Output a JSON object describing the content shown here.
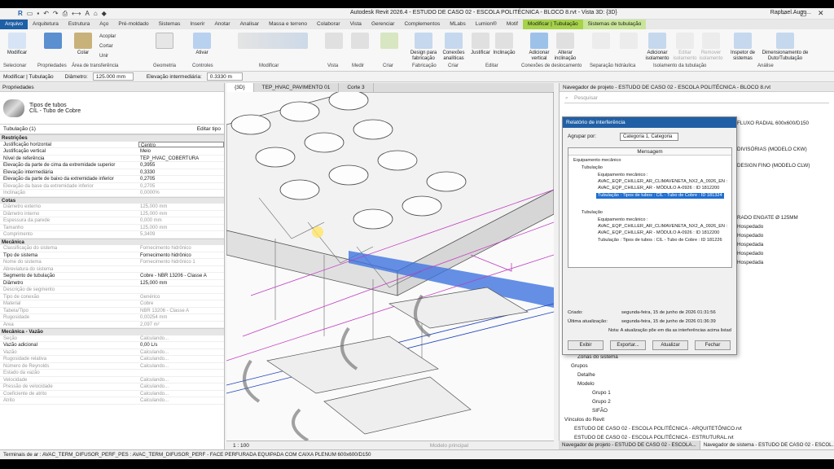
{
  "title": {
    "app": "Autodesk Revit 2026.4 - ESTUDO DE CASO 02 - ESCOLA POLITÉCNICA - BLOCO 8.rvt - Vista 3D: {3D}",
    "user": "Raphael.Augu..."
  },
  "tabs": [
    "Arquivo",
    "Arquitetura",
    "Estrutura",
    "Aço",
    "Pré-moldado",
    "Sistemas",
    "Inserir",
    "Anotar",
    "Analisar",
    "Massa e terreno",
    "Colaborar",
    "Vista",
    "Gerenciar",
    "Complementos",
    "MLabs",
    "Lumion®",
    "Motif",
    "Modificar | Tubulação",
    "Sistemas de tubulação"
  ],
  "ribbon": {
    "modify": "Modificar",
    "select": "Selecionar",
    "properties": "Propriedades",
    "clipboard": "Área de transferência",
    "geometry": "Geometria",
    "controls": "Controles",
    "modify_group": "Modificar",
    "view": "Vista",
    "measure": "Medir",
    "create": "Criar",
    "fabrication": "Fabricação",
    "create2": "Criar",
    "edit": "Editar",
    "offset_conn": "Conexões de deslocamento",
    "hydr_sep": "Separação hidráulica",
    "insul": "Isolamento da tubulação",
    "analysis": "Análise",
    "paste": "Colar",
    "cut": "Cortar",
    "join": "Unir",
    "copy": "Acoplar",
    "activate": "Ativar",
    "design_fab": "Design para fabricação",
    "analytic_conn": "Conexões analíticas",
    "justify": "Justificar",
    "slope": "Inclinação",
    "add_vertical": "Adicionar vertical",
    "change_slope": "Alterar inclinação",
    "add_insul": "Adicionar isolamento",
    "edit_insul": "Editar isolamento",
    "remove_insul": "Remover isolamento",
    "inspector": "Inspetor de sistemas",
    "sizing": "Dimensionamento de Duto/Tubulação"
  },
  "optbar": {
    "context": "Modificar | Tubulação",
    "diam_label": "Diâmetro:",
    "diam_value": "125.000 mm",
    "elev_label": "Elevação intermediária:",
    "elev_value": "0.3330 m"
  },
  "props": {
    "header": "Propriedades",
    "type_family": "Tipos de tubos",
    "type_name": "CIL - Tubo de Cobre",
    "selector": "Tubulação (1)",
    "edit_type": "Editar tipo",
    "sections": [
      {
        "name": "Restrições",
        "rows": [
          [
            "Justificação horizontal",
            "Centro",
            0,
            1
          ],
          [
            "Justificação vertical",
            "Meio",
            0,
            0
          ],
          [
            "Nível de referência",
            "TEP_HVAC_COBERTURA",
            0,
            0
          ],
          [
            "Elevação da parte de cima da extremidade superior",
            "0,3955",
            0,
            0
          ],
          [
            "Elevação intermediária",
            "0,3330",
            0,
            0
          ],
          [
            "Elevação da parte de baixo da extremidade inferior",
            "0,2705",
            0,
            0
          ],
          [
            "Elevação da base da extremidade inferior",
            "0,2705",
            1,
            0
          ],
          [
            "Inclinação",
            "0,0000%",
            1,
            0
          ]
        ]
      },
      {
        "name": "Cotas",
        "rows": [
          [
            "Diâmetro externo",
            "125,000 mm",
            1,
            0
          ],
          [
            "Diâmetro interno",
            "125,000 mm",
            1,
            0
          ],
          [
            "Espessura da parede",
            "0,000 mm",
            1,
            0
          ],
          [
            "Tamanho",
            "125,000 mm",
            1,
            0
          ],
          [
            "Comprimento",
            "5,3409",
            1,
            0
          ]
        ]
      },
      {
        "name": "Mecânica",
        "rows": [
          [
            "Classificação do sistema",
            "Fornecimento hidrônico",
            1,
            0
          ],
          [
            "Tipo de sistema",
            "Fornecimento hidrônico",
            0,
            0
          ],
          [
            "Nome do sistema",
            "Fornecimento hidrônico 1",
            1,
            0
          ],
          [
            "Abreviatura do sistema",
            "",
            1,
            0
          ],
          [
            "Segmento de tubulação",
            "Cobre - NBR 13206 - Classe A",
            0,
            0
          ],
          [
            "Diâmetro",
            "125,000 mm",
            0,
            0
          ],
          [
            "Descrição de segmento",
            "",
            1,
            0
          ],
          [
            "Tipo de conexão",
            "Genérico",
            1,
            0
          ],
          [
            "Material",
            "Cobre",
            1,
            0
          ],
          [
            "Tabela/Tipo",
            "NBR 13206 - Classe A",
            1,
            0
          ],
          [
            "Rugosidade",
            "0,00254 mm",
            1,
            0
          ],
          [
            "Área",
            "2,097 m²",
            1,
            0
          ]
        ]
      },
      {
        "name": "Mecânica - Vazão",
        "rows": [
          [
            "Seção",
            "Calculando...",
            1,
            0
          ],
          [
            "Vazão adicional",
            "0,00 L/s",
            0,
            0
          ],
          [
            "Vazão",
            "Calculando...",
            1,
            0
          ],
          [
            "Rugosidade relativa",
            "Calculando...",
            1,
            0
          ],
          [
            "Número de Reynolds",
            "Calculando...",
            1,
            0
          ],
          [
            "Estado da vazão",
            "",
            1,
            0
          ],
          [
            "Velocidade",
            "Calculando...",
            1,
            0
          ],
          [
            "Pressão de velocidade",
            "Calculando...",
            1,
            0
          ],
          [
            "Coeficiente de atrito",
            "Calculando...",
            1,
            0
          ],
          [
            "Atrito",
            "Calculando...",
            1,
            0
          ]
        ]
      }
    ],
    "help": "Ajuda de propriedades",
    "apply": "Aplicar"
  },
  "view_tabs": [
    "{3D}",
    "TEP_HVAC_PAVIMENTO 01",
    "Corte 3"
  ],
  "view_scale": "1 : 100",
  "view_label": "Modelo principal",
  "browser": {
    "title": "Navegador de projeto - ESTUDO DE CASO 02 - ESCOLA POLITÉCNICA - BLOCO 8.rvt",
    "search": "Pesquisar",
    "items": [
      "FLUXO RADIAL 600x600/D150",
      "DIVISÓRIAS (MODELO CKW)",
      "DESIGN FINO (MODELO CLW)",
      "RADO ENGATE Ø 125MM",
      "Hospedado",
      "Hospedado",
      "Hospedada",
      "Hospedado",
      "Hospedada",
      "Zonas do sistema",
      "Grupos",
      "Detalhe",
      "Modelo",
      "Grupo 1",
      "Grupo 2",
      "SIFÃO",
      "Vínculos do Revit",
      "ESTUDO DE CASO 02 - ESCOLA POLITÉCNICA - ARQUITETÔNICO.rvt",
      "ESTUDO DE CASO 02 - ESCOLA POLITÉCNICA - ESTRUTURAL.rvt"
    ],
    "tab1": "Navegador de projeto - ESTUDO DE CASO 02 - ESCOLA...",
    "tab2": "Navegador de sistema - ESTUDO DE CASO 02 - ESCOL..."
  },
  "dialog": {
    "title": "Relatório de interferência",
    "group_label": "Agrupar por:",
    "group_value": "Categoria 1, Categoria",
    "col": "Mensagem",
    "lines": [
      "Equipamento mecânico",
      "Tubulação",
      "Equipamento mecânico :",
      "AVAC_EQP_CHILLER_AR_CLIMAVENETA_NX2_A_0926_EN :",
      "AVAC_EQP_CHILLER_AR - MÓDULO A-0926 : ID 1812200",
      "Tubulação : Tipos de tubos : CIL - Tubo de Cobre : ID 181324",
      "Tubulação",
      "Equipamento mecânico :",
      "AVAC_EQP_CHILLER_AR_CLIMAVENETA_NX2_A_0926_EN :",
      "AVAC_EQP_CHILLER_AR - MÓDULO A-0926 : ID 1812200",
      "Tubulação : Tipos de tubos : CIL - Tubo de Cobre : ID 181226"
    ],
    "created_label": "Criado:",
    "created": "segunda-feira, 15 de junho de 2026 01:31:56",
    "updated_label": "Última atualização:",
    "updated": "segunda-feira, 15 de junho de 2026 01:36:39",
    "note": "Nota: A atualização põe em dia as interferências acima listad",
    "btn_show": "Exibir",
    "btn_export": "Exportar...",
    "btn_update": "Atualizar",
    "btn_close": "Fechar"
  },
  "status": "Terminais de ar : AVAC_TERM_DIFUSOR_PERF_PES : AVAC_TERM_DIFUSOR_PERF - FACE PERFURADA EQUIPADA COM CAIXA PLENUM 600x600/D150"
}
